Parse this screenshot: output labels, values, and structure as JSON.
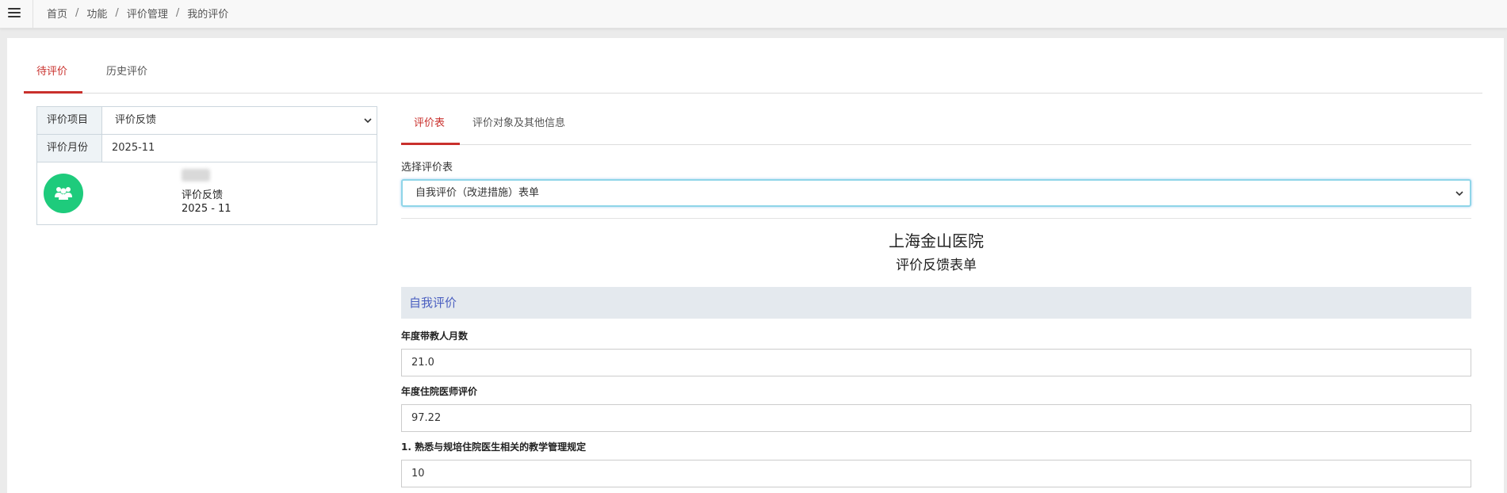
{
  "breadcrumb": [
    "首页",
    "功能",
    "评价管理",
    "我的评价"
  ],
  "main_tabs": [
    {
      "label": "待评价",
      "active": true
    },
    {
      "label": "历史评价",
      "active": false
    }
  ],
  "left_panel": {
    "project_label": "评价项目",
    "project_value": "评价反馈",
    "month_label": "评价月份",
    "month_value": "2025-11",
    "info_name": "评价反馈",
    "info_date": "2025 - 11"
  },
  "sub_tabs": [
    {
      "label": "评价表",
      "active": true
    },
    {
      "label": "评价对象及其他信息",
      "active": false
    }
  ],
  "sheet_select": {
    "label": "选择评价表",
    "value": "自我评价（改进措施）表单"
  },
  "form": {
    "hospital": "上海金山医院",
    "title": "评价反馈表单",
    "section": "自我评价",
    "fields": [
      {
        "label": "年度带教人月数",
        "value": "21.0"
      },
      {
        "label": "年度住院医师评价",
        "value": "97.22"
      },
      {
        "label": "1. 熟悉与规培住院医生相关的教学管理规定",
        "value": "10"
      }
    ]
  },
  "colors": {
    "active_tab": "#c9302c",
    "avatar_bg": "#1ecb7c",
    "section_text": "#4a5fc0",
    "section_bg": "#e4e9ee"
  },
  "icons": {
    "menu": "hamburger-menu-icon",
    "avatar": "users-icon",
    "dropdown": "chevron-down-icon"
  }
}
